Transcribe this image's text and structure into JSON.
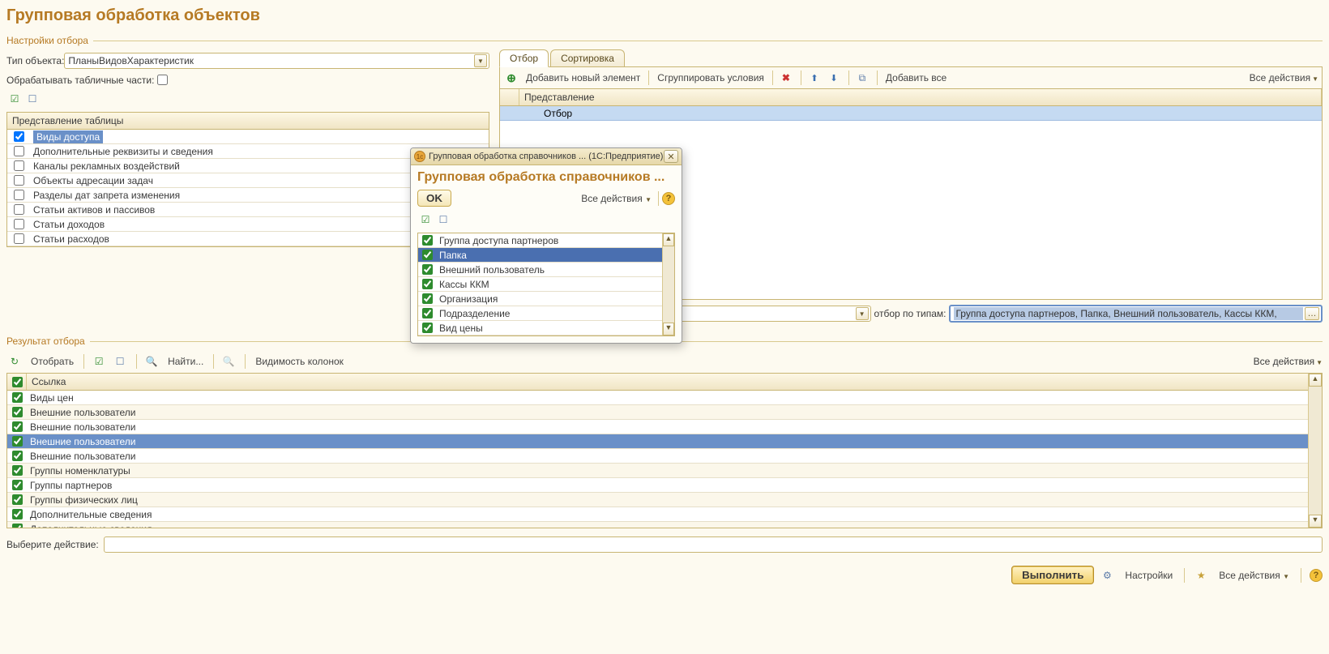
{
  "page_title": "Групповая обработка объектов",
  "groups": {
    "settings": "Настройки отбора",
    "results": "Результат отбора"
  },
  "form": {
    "type_label": "Тип объекта:",
    "type_value": "ПланыВидовХарактеристик",
    "tabular_label": "Обрабатывать табличные части:",
    "tabular_checked": false,
    "table_repr_header": "Представление таблицы",
    "tables": [
      {
        "checked": true,
        "label": "Виды доступа",
        "selected": true
      },
      {
        "checked": false,
        "label": "Дополнительные реквизиты и сведения"
      },
      {
        "checked": false,
        "label": "Каналы рекламных воздействий"
      },
      {
        "checked": false,
        "label": "Объекты адресации задач"
      },
      {
        "checked": false,
        "label": "Разделы дат запрета изменения"
      },
      {
        "checked": false,
        "label": "Статьи активов и пассивов"
      },
      {
        "checked": false,
        "label": "Статьи доходов"
      },
      {
        "checked": false,
        "label": "Статьи расходов"
      }
    ]
  },
  "tabs": {
    "filter": "Отбор",
    "sort": "Сортировка",
    "active": "filter"
  },
  "filter_toolbar": {
    "add": "Добавить новый элемент",
    "group": "Сгруппировать условия",
    "add_all": "Добавить все",
    "all_actions": "Все действия"
  },
  "filter_grid": {
    "col_repr": "Представление",
    "rows": [
      {
        "indent": 24,
        "label": "Отбор",
        "selected": true
      }
    ]
  },
  "type_filter": {
    "label": "отбор по типам:",
    "value": "Группа доступа партнеров, Папка, Внешний пользователь, Кассы ККМ,"
  },
  "result_toolbar": {
    "select": "Отобрать",
    "find": "Найти...",
    "visibility": "Видимость колонок",
    "all_actions": "Все действия"
  },
  "result_grid": {
    "col_link": "Ссылка",
    "rows": [
      {
        "checked": true,
        "label": "Виды цен"
      },
      {
        "checked": true,
        "label": "Внешние пользователи"
      },
      {
        "checked": true,
        "label": "Внешние пользователи"
      },
      {
        "checked": true,
        "label": "Внешние пользователи",
        "selected": true
      },
      {
        "checked": true,
        "label": "Внешние пользователи"
      },
      {
        "checked": true,
        "label": "Группы номенклатуры"
      },
      {
        "checked": true,
        "label": "Группы партнеров"
      },
      {
        "checked": true,
        "label": "Группы физических лиц"
      },
      {
        "checked": true,
        "label": "Дополнительные сведения"
      },
      {
        "checked": true,
        "label": "Дополнительные сведения"
      }
    ]
  },
  "bottom": {
    "choose_action_label": "Выберите действие:"
  },
  "footer": {
    "execute": "Выполнить",
    "settings": "Настройки",
    "all_actions": "Все действия"
  },
  "modal": {
    "title_bar": "Групповая обработка справочников ...  (1С:Предприятие)",
    "heading": "Групповая обработка справочников ...",
    "ok": "OK",
    "all_actions": "Все действия",
    "items": [
      {
        "checked": true,
        "label": "Группа доступа партнеров"
      },
      {
        "checked": true,
        "label": "Папка",
        "selected": true
      },
      {
        "checked": true,
        "label": "Внешний пользователь"
      },
      {
        "checked": true,
        "label": "Кассы ККМ"
      },
      {
        "checked": true,
        "label": "Организация"
      },
      {
        "checked": true,
        "label": "Подразделение"
      },
      {
        "checked": true,
        "label": "Вид цены"
      }
    ]
  }
}
